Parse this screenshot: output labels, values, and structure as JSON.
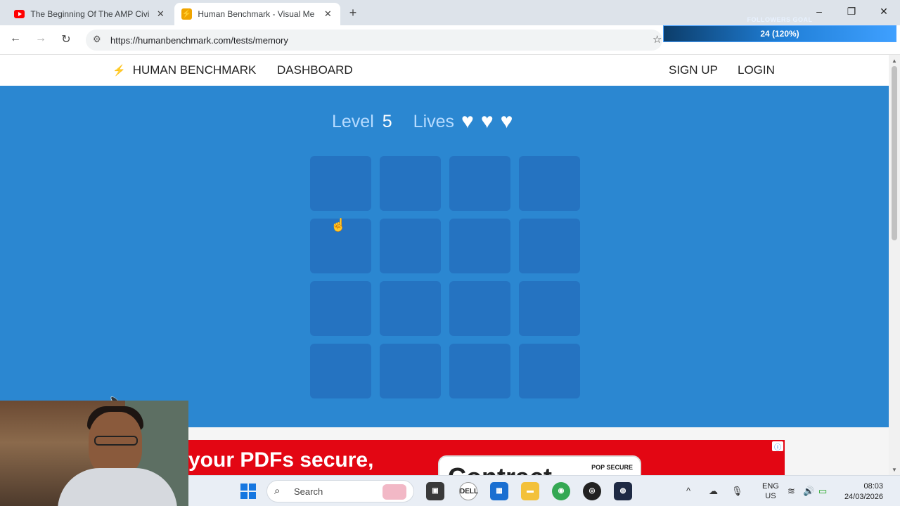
{
  "browser": {
    "tabs": [
      {
        "title": "The Beginning Of The AMP Civi",
        "favicon": "youtube-icon"
      },
      {
        "title": "Human Benchmark - Visual Me",
        "favicon": "humanbenchmark-bolt-icon"
      }
    ],
    "url": "https://humanbenchmark.com/tests/memory"
  },
  "overlay": {
    "label": "FOLLOWERS GOAL",
    "value_text": "24 (120%)",
    "progress": 1.0
  },
  "site": {
    "brand": "HUMAN BENCHMARK",
    "nav": {
      "dashboard": "DASHBOARD",
      "signup": "SIGN UP",
      "login": "LOGIN"
    }
  },
  "test": {
    "level_label": "Level",
    "level_value": "5",
    "lives_label": "Lives",
    "lives": 3,
    "grid_size": 4,
    "tile_color": "#2573c1",
    "background_color": "#2b87d1"
  },
  "ad": {
    "headline": "your PDFs secure,",
    "card_text": "Contract",
    "card_small": "POP SECURE"
  },
  "taskbar": {
    "search_placeholder": "Search",
    "language": "ENG",
    "region": "US",
    "time": "08:03",
    "date": "24/03/2026"
  }
}
